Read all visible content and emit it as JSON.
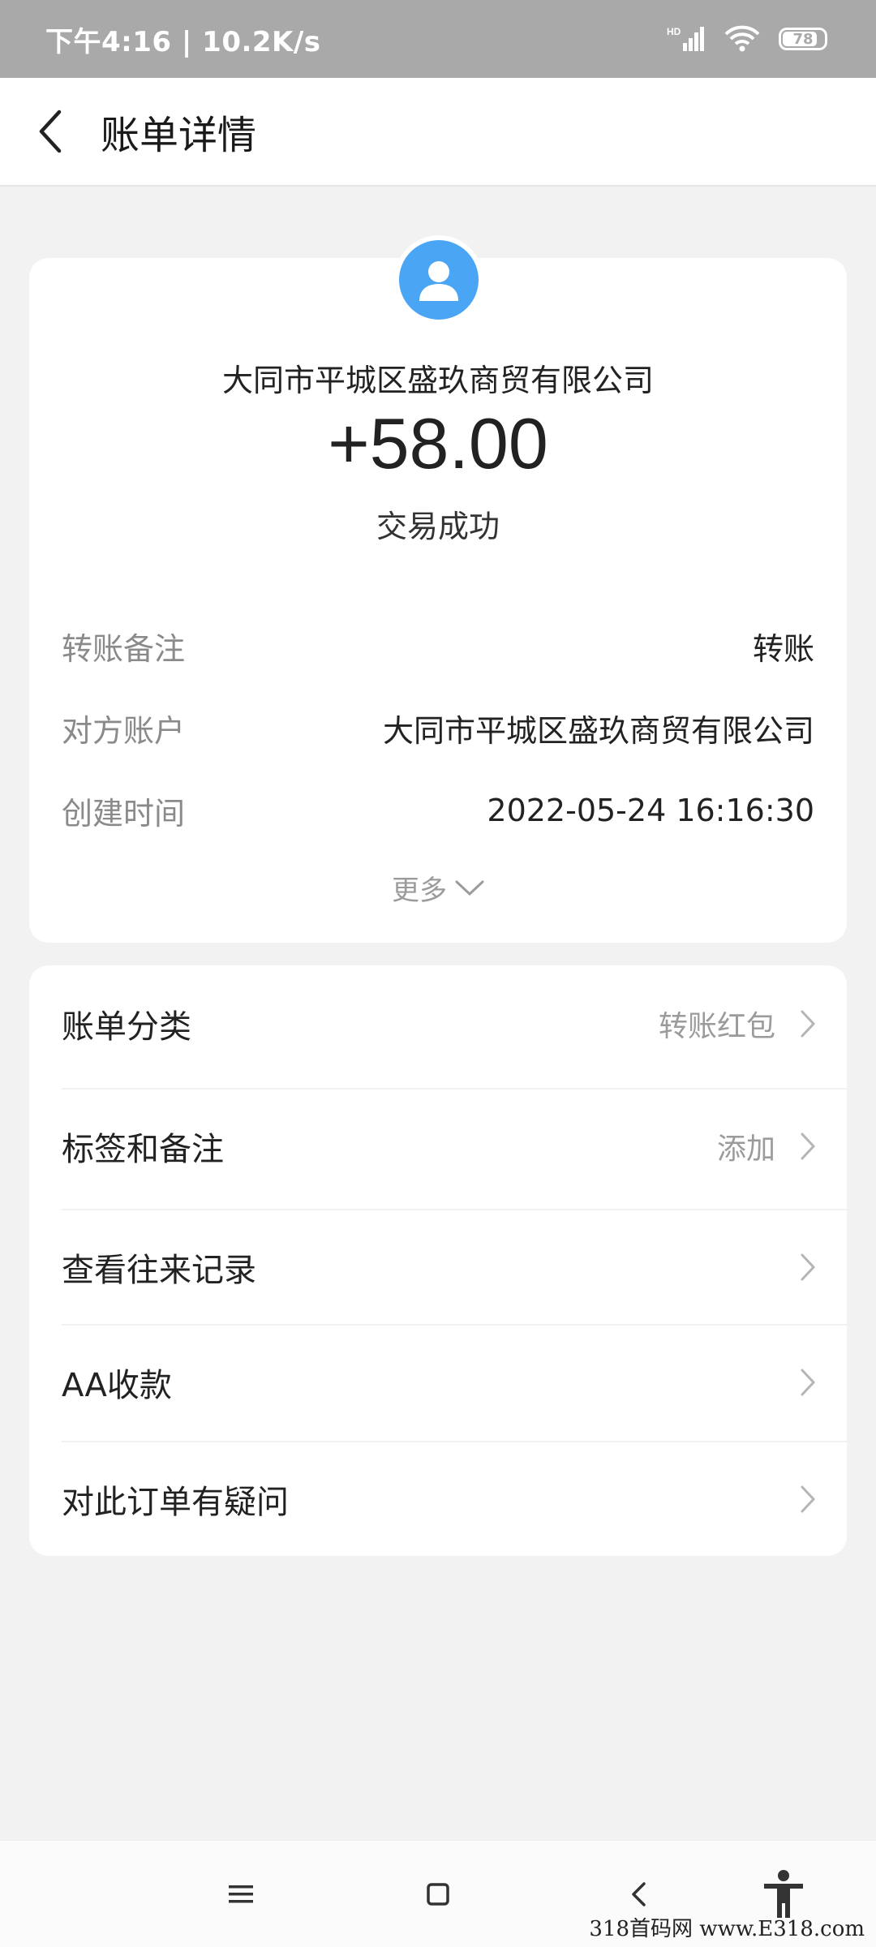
{
  "status_bar": {
    "time_speed": "下午4:16 | 10.2K/s",
    "network_badge": "HD",
    "battery": "78"
  },
  "header": {
    "title": "账单详情"
  },
  "transaction": {
    "counterparty": "大同市平城区盛玖商贸有限公司",
    "amount": "+58.00",
    "status": "交易成功",
    "details": [
      {
        "label": "转账备注",
        "value": "转账"
      },
      {
        "label": "对方账户",
        "value": "大同市平城区盛玖商贸有限公司"
      },
      {
        "label": "创建时间",
        "value": "2022-05-24 16:16:30"
      }
    ],
    "more_label": "更多"
  },
  "menu": {
    "items": [
      {
        "label": "账单分类",
        "value": "转账红包"
      },
      {
        "label": "标签和备注",
        "value": "添加"
      },
      {
        "label": "查看往来记录",
        "value": ""
      },
      {
        "label": "AA收款",
        "value": ""
      },
      {
        "label": "对此订单有疑问",
        "value": ""
      }
    ]
  },
  "watermark": "318首码网 www.E318.com",
  "colors": {
    "accent": "#4aa6f5",
    "status_bar_bg": "#a9a9a9",
    "page_bg": "#f2f2f3"
  }
}
